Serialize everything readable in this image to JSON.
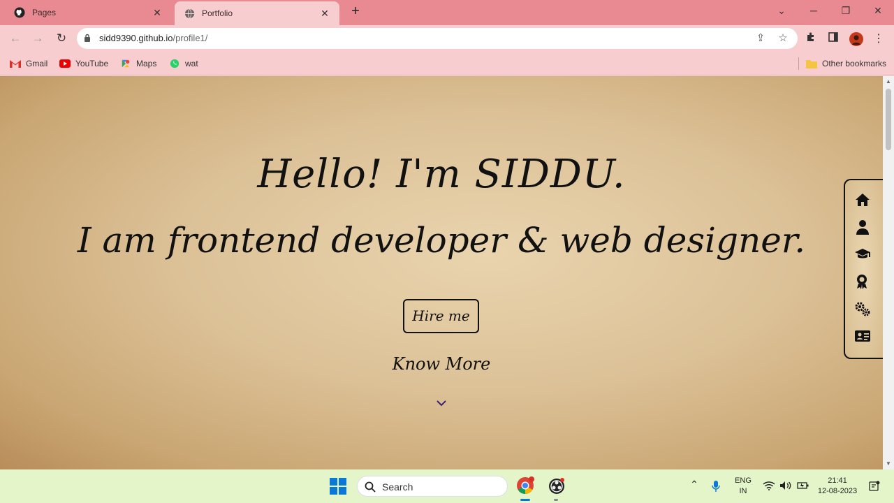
{
  "browser": {
    "tabs": [
      {
        "title": "Pages",
        "icon": "github-icon"
      },
      {
        "title": "Portfolio",
        "icon": "globe-icon"
      }
    ],
    "address": {
      "host": "sidd9390.github.io",
      "path": "/profile1/"
    },
    "bookmarks": [
      "Gmail",
      "YouTube",
      "Maps",
      "wat"
    ],
    "other_bookmarks": "Other bookmarks"
  },
  "page": {
    "heading": "Hello! I'm SIDDU.",
    "subtitle": "I am frontend developer & web designer.",
    "hire_button": "Hire me",
    "know_more": "Know More",
    "nav_icons": [
      "home-icon",
      "user-icon",
      "graduation-cap-icon",
      "award-icon",
      "gears-icon",
      "contact-card-icon"
    ]
  },
  "taskbar": {
    "search_placeholder": "Search",
    "language": "ENG",
    "region": "IN",
    "time": "21:41",
    "date": "12-08-2023"
  },
  "colors": {
    "tab_strip": "#e98a92",
    "toolbar": "#f8cdd0",
    "taskbar": "#e4f6c9",
    "parchment": "#dcc197"
  }
}
